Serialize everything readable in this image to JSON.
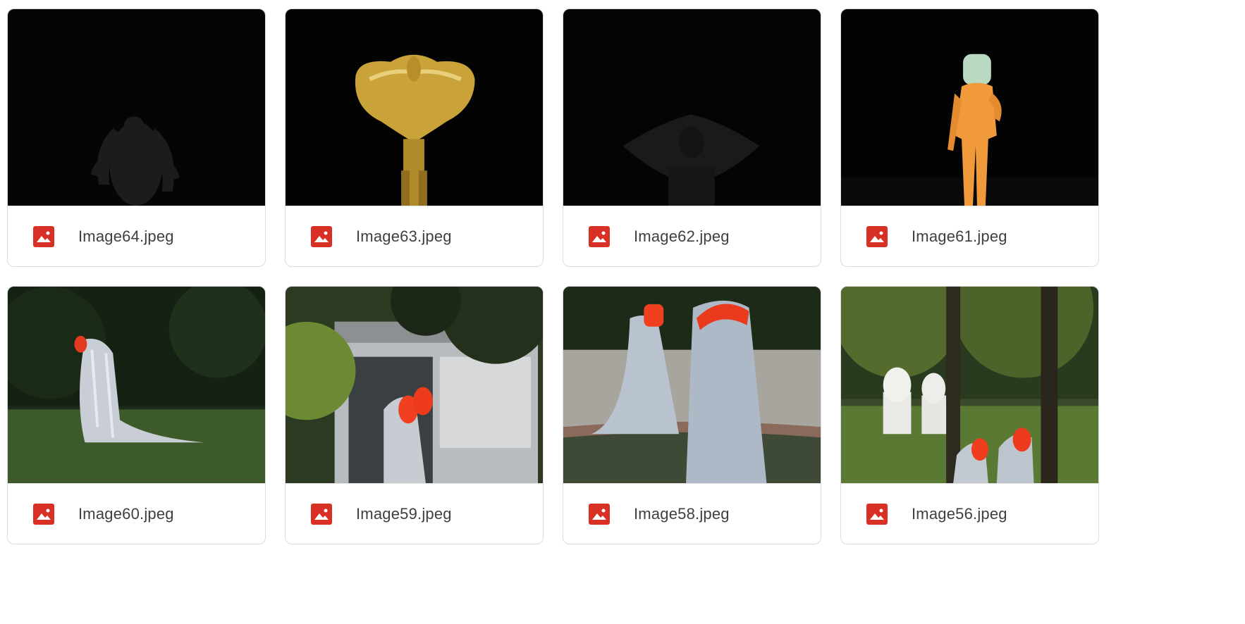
{
  "files": [
    {
      "name": "Image64.jpeg",
      "icon": "image-file-icon",
      "thumbnail": "dark-figure-with-limbs"
    },
    {
      "name": "Image63.jpeg",
      "icon": "image-file-icon",
      "thumbnail": "gold-inflatable-figure"
    },
    {
      "name": "Image62.jpeg",
      "icon": "image-file-icon",
      "thumbnail": "dark-pillow-figure"
    },
    {
      "name": "Image61.jpeg",
      "icon": "image-file-icon",
      "thumbnail": "orange-suit-mask-figure"
    },
    {
      "name": "Image60.jpeg",
      "icon": "image-file-icon",
      "thumbnail": "silver-cloak-on-grass"
    },
    {
      "name": "Image59.jpeg",
      "icon": "image-file-icon",
      "thumbnail": "silver-figure-by-building"
    },
    {
      "name": "Image58.jpeg",
      "icon": "image-file-icon",
      "thumbnail": "silver-figures-at-fountain"
    },
    {
      "name": "Image56.jpeg",
      "icon": "image-file-icon",
      "thumbnail": "silver-figures-in-garden"
    }
  ],
  "colors": {
    "icon_red": "#d93025",
    "text": "#3c4043",
    "border": "#dadce0"
  }
}
